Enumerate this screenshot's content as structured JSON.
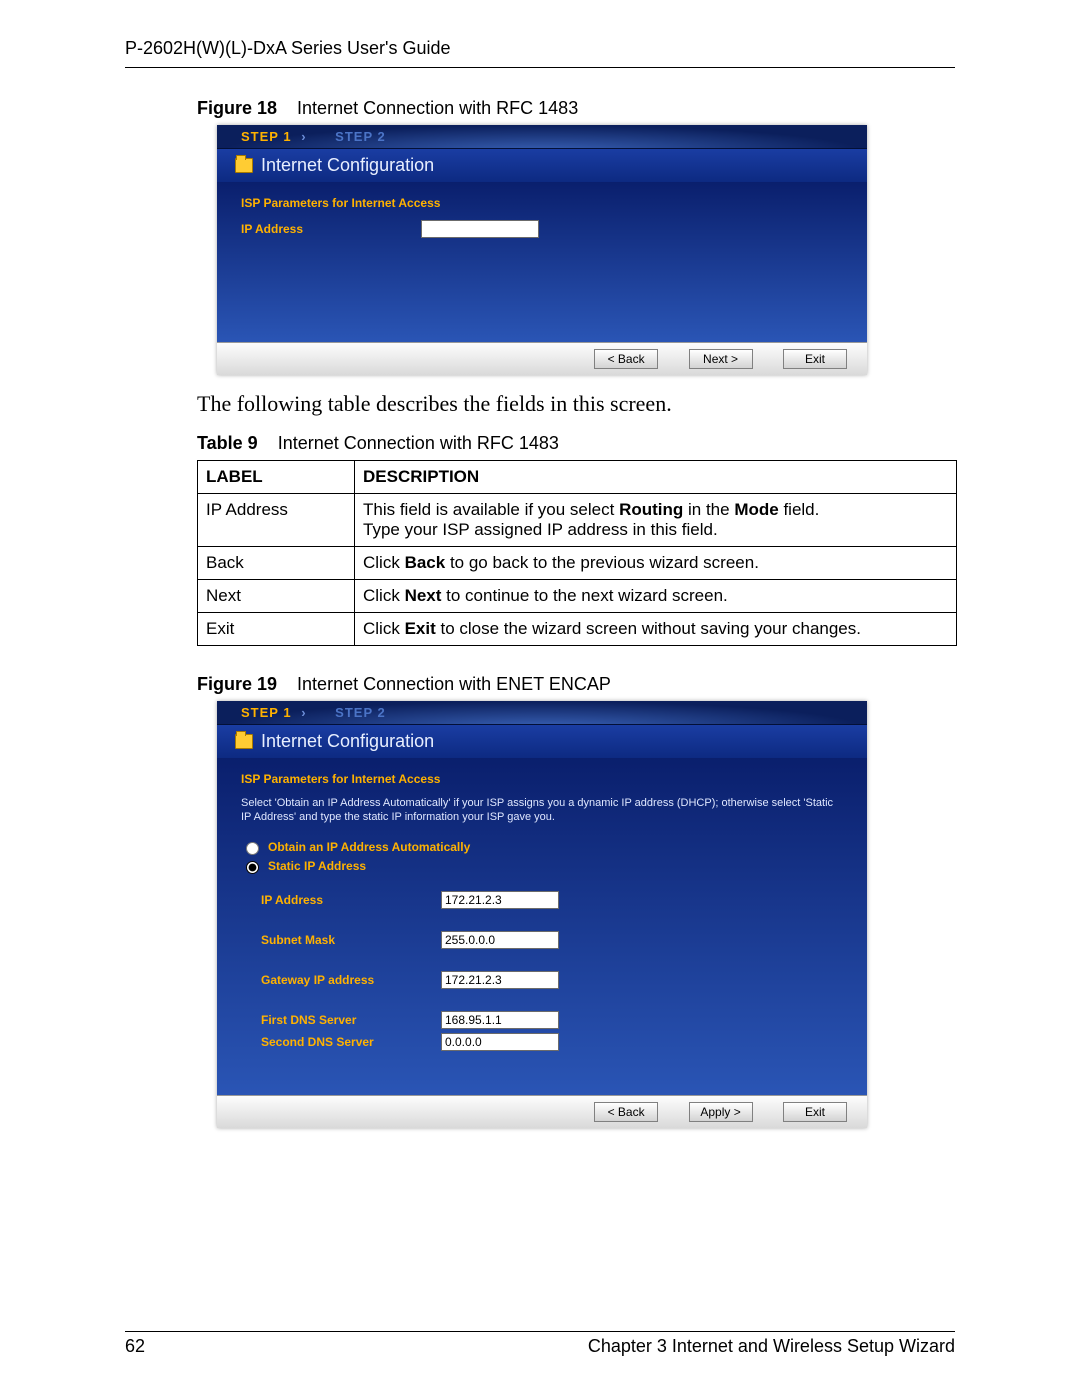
{
  "header": {
    "running_title": "P-2602H(W)(L)-DxA Series User's Guide"
  },
  "figure18": {
    "caption_prefix": "Figure 18",
    "caption_text": "Internet Connection with RFC 1483",
    "steps": {
      "active": "STEP 1",
      "passive": "STEP 2"
    },
    "panel_title": "Internet Configuration",
    "section_label": "ISP Parameters for Internet Access",
    "fields": {
      "ip_label": "IP Address",
      "ip_value": ""
    },
    "buttons": {
      "back": "< Back",
      "next": "Next >",
      "exit": "Exit"
    }
  },
  "between_text": "The following table describes the fields in this screen.",
  "table9": {
    "caption_prefix": "Table 9",
    "caption_text": "Internet Connection with RFC 1483",
    "head": {
      "label": "LABEL",
      "desc": "DESCRIPTION"
    },
    "rows": [
      {
        "label": "IP Address",
        "desc_pre": "This field is available if you select ",
        "desc_b1": "Routing",
        "desc_mid": " in the ",
        "desc_b2": "Mode",
        "desc_post": " field.",
        "desc_line2": "Type your ISP assigned IP address in this field."
      },
      {
        "label": "Back",
        "desc_pre": "Click ",
        "desc_b1": "Back",
        "desc_post": " to go back to the previous wizard screen."
      },
      {
        "label": "Next",
        "desc_pre": "Click ",
        "desc_b1": "Next",
        "desc_post": " to continue to the next wizard screen."
      },
      {
        "label": "Exit",
        "desc_pre": "Click ",
        "desc_b1": "Exit",
        "desc_post": " to close the wizard screen without saving your changes."
      }
    ]
  },
  "figure19": {
    "caption_prefix": "Figure 19",
    "caption_text": "Internet Connection with ENET ENCAP",
    "steps": {
      "active": "STEP 1",
      "passive": "STEP 2"
    },
    "panel_title": "Internet Configuration",
    "section_label": "ISP Parameters for Internet Access",
    "helptext": "Select 'Obtain an IP Address Automatically' if your ISP assigns you a dynamic IP address (DHCP); otherwise select 'Static IP Address' and type the static IP information your ISP gave you.",
    "radio": {
      "auto": "Obtain an IP Address Automatically",
      "static": "Static IP Address"
    },
    "fields": {
      "ip_label": "IP Address",
      "ip_value": "172.21.2.3",
      "mask_label": "Subnet Mask",
      "mask_value": "255.0.0.0",
      "gw_label": "Gateway IP address",
      "gw_value": "172.21.2.3",
      "dns1_label": "First DNS Server",
      "dns1_value": "168.95.1.1",
      "dns2_label": "Second DNS Server",
      "dns2_value": "0.0.0.0"
    },
    "buttons": {
      "back": "< Back",
      "apply": "Apply >",
      "exit": "Exit"
    }
  },
  "footer": {
    "page_number": "62",
    "chapter": "Chapter 3 Internet and Wireless Setup Wizard"
  }
}
